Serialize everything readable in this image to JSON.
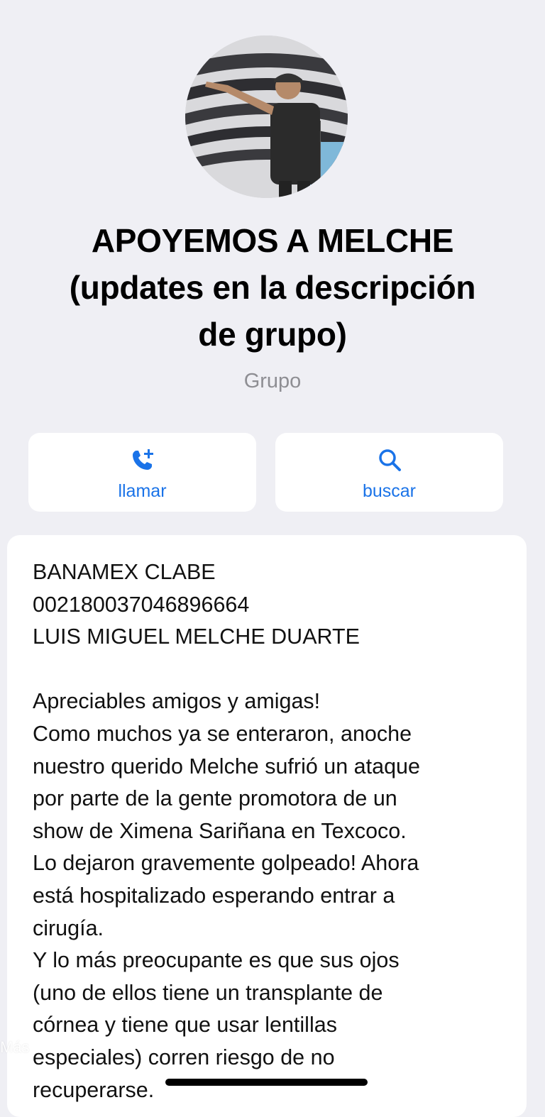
{
  "group": {
    "title_lines": [
      "APOYEMOS A MELCHE",
      "(updates en la descripción",
      "de grupo)"
    ],
    "subtitle": "Grupo"
  },
  "actions": {
    "call": {
      "label": "llamar",
      "icon": "phone-add-icon"
    },
    "search": {
      "label": "buscar",
      "icon": "search-icon"
    }
  },
  "description": {
    "bank_lines": [
      "BANAMEX CLABE",
      "002180037046896664",
      "LUIS MIGUEL MELCHE DUARTE"
    ],
    "message_lines": [
      "Apreciables amigos y amigas!",
      "Como muchos ya se enteraron, anoche",
      "nuestro querido Melche sufrió un ataque",
      "por parte de la gente promotora de un",
      "show de Ximena Sariñana en Texcoco.",
      "Lo dejaron gravemente golpeado! Ahora",
      "está hospitalizado esperando entrar a",
      "cirugía.",
      "Y lo más preocupante es que sus ojos",
      "(uno de ellos tiene un transplante de",
      "córnea y tiene que usar lentillas",
      "especiales) corren riesgo de no",
      "recuperarse."
    ]
  },
  "overlay": {
    "more_label": "Más"
  },
  "colors": {
    "background": "#efeff4",
    "accent": "#1a73e8",
    "secondary_text": "#8e8e93"
  }
}
